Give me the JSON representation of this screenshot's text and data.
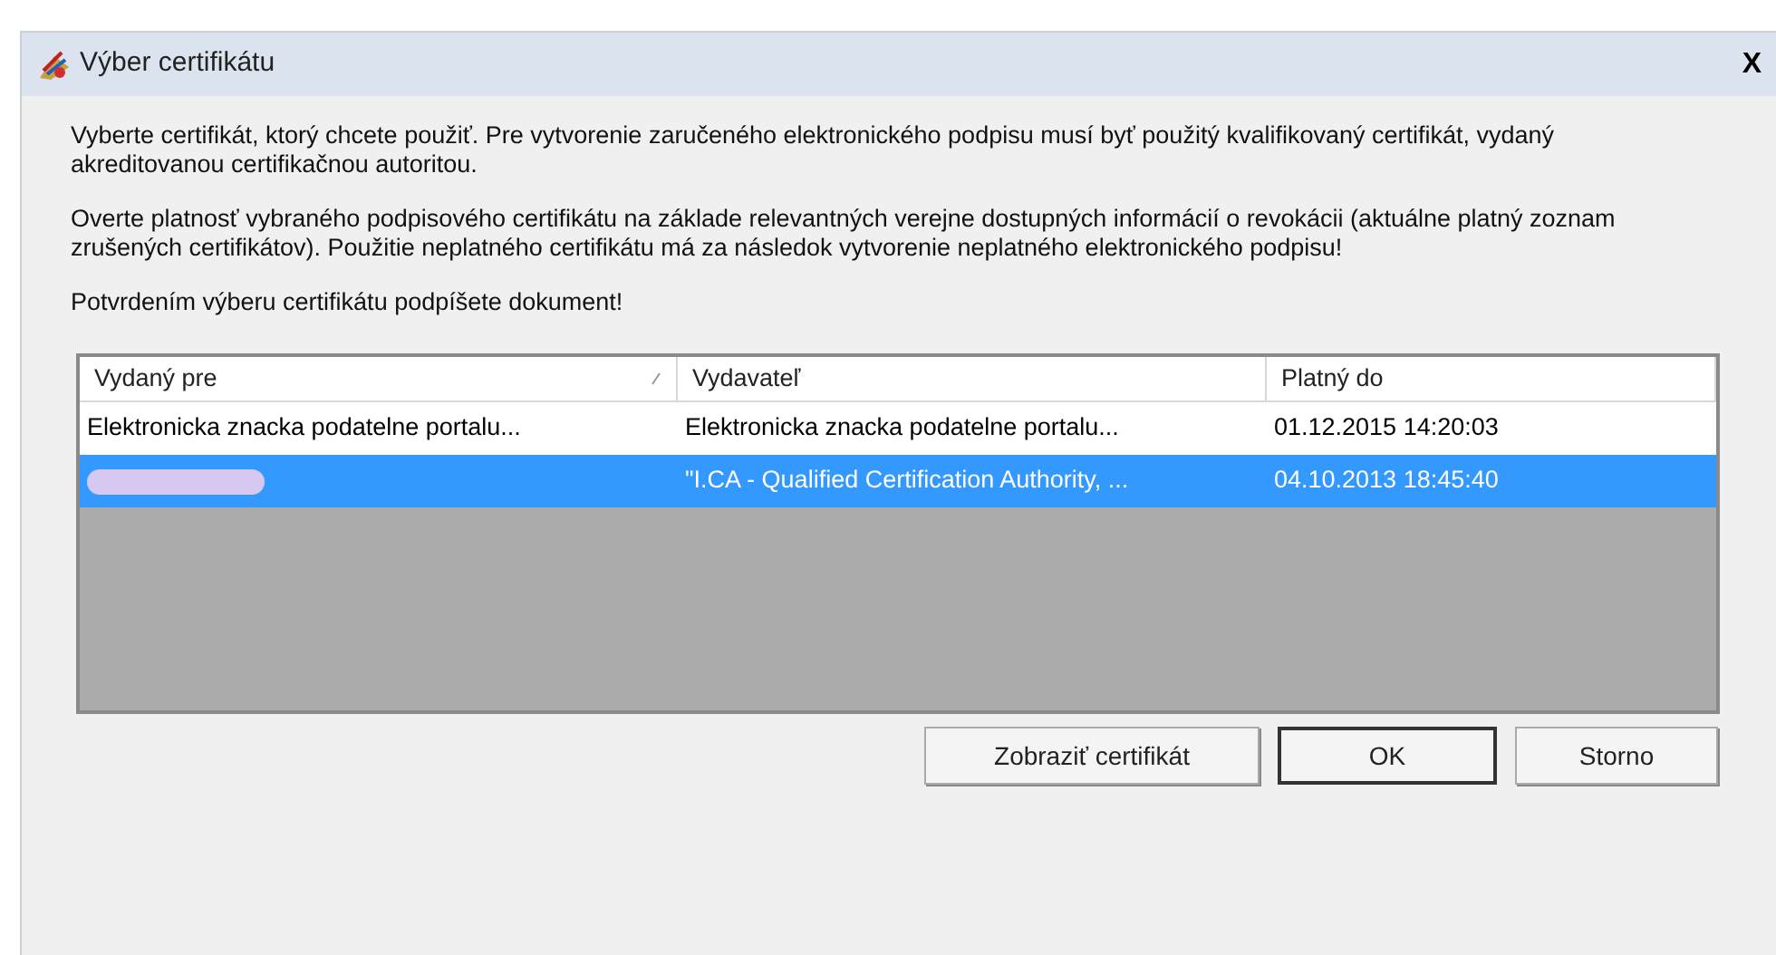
{
  "window": {
    "title": "Výber certifikátu",
    "close": "X"
  },
  "paragraphs": [
    "Vyberte certifikát, ktorý chcete použiť. Pre vytvorenie zaručeného elektronického podpisu musí byť použitý kvalifikovaný certifikát, vydaný akreditovanou certifikačnou autoritou.",
    "Overte platnosť vybraného podpisového certifikátu na základe relevantných verejne dostupných informácií o revokácii (aktuálne platný zoznam zrušených certifikátov). Použitie neplatného certifikátu má za následok vytvorenie neplatného elektronického podpisu!",
    "Potvrdením výberu certifikátu podpíšete dokument!"
  ],
  "table": {
    "columns": [
      {
        "label": "Vydaný pre",
        "sorted": true
      },
      {
        "label": "Vydavateľ",
        "sorted": false
      },
      {
        "label": "Platný do",
        "sorted": false
      }
    ],
    "rows": [
      {
        "selected": false,
        "redacted": false,
        "cells": [
          "Elektronicka znacka podatelne portalu...",
          "Elektronicka znacka podatelne portalu...",
          "01.12.2015 14:20:03"
        ]
      },
      {
        "selected": true,
        "redacted": true,
        "cells": [
          "",
          "\"I.CA - Qualified Certification Authority, ...",
          "04.10.2013 18:45:40"
        ]
      }
    ]
  },
  "buttons": [
    {
      "label": "Zobraziť certifikát",
      "default": false
    },
    {
      "label": "OK",
      "default": true
    },
    {
      "label": "Storno",
      "default": false
    }
  ]
}
